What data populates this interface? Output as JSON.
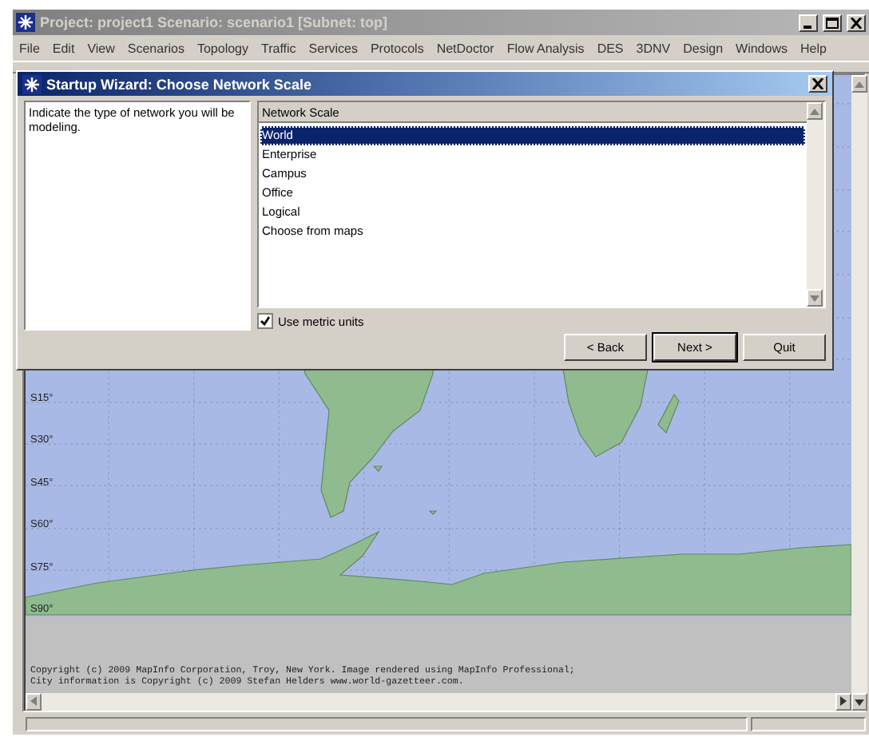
{
  "window": {
    "title": "Project: project1 Scenario: scenario1  [Subnet: top]"
  },
  "menu": [
    "File",
    "Edit",
    "View",
    "Scenarios",
    "Topology",
    "Traffic",
    "Services",
    "Protocols",
    "NetDoctor",
    "Flow Analysis",
    "DES",
    "3DNV",
    "Design",
    "Windows",
    "Help"
  ],
  "map": {
    "latitude_labels": [
      "S15°",
      "S30°",
      "S45°",
      "S60°",
      "S75°",
      "S90°"
    ],
    "copyright": [
      "Copyright (c) 2009 MapInfo Corporation, Troy, New York. Image rendered using MapInfo Professional;",
      "City information is Copyright (c) 2009 Stefan Helders www.world-gazetteer.com."
    ]
  },
  "dialog": {
    "title": "Startup Wizard: Choose Network Scale",
    "description": "Indicate the type of network you will be modeling.",
    "list_header": "Network Scale",
    "items": [
      {
        "label": "World",
        "selected": true
      },
      {
        "label": "Enterprise",
        "selected": false
      },
      {
        "label": "Campus",
        "selected": false
      },
      {
        "label": "Office",
        "selected": false
      },
      {
        "label": "Logical",
        "selected": false
      },
      {
        "label": "Choose from maps",
        "selected": false
      }
    ],
    "metric_units": {
      "label": "Use metric units",
      "checked": true
    },
    "buttons": [
      {
        "label": "< Back",
        "default": false
      },
      {
        "label": "Next >",
        "default": true
      },
      {
        "label": "Quit",
        "default": false
      }
    ]
  }
}
